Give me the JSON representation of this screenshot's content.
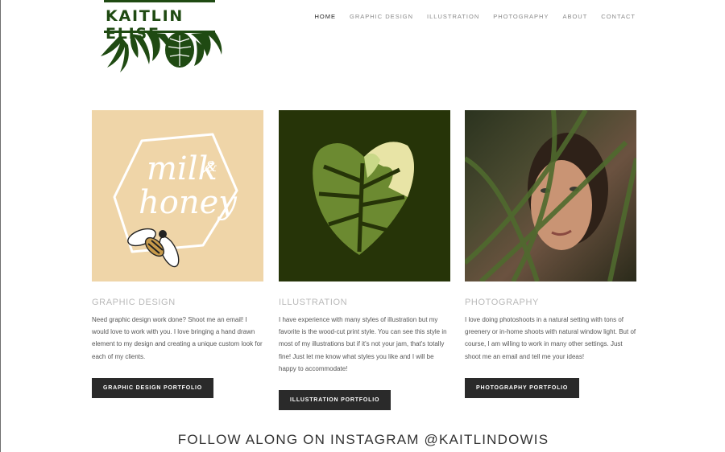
{
  "brand": {
    "name": "KAITLIN ELISE",
    "color": "#1f4a12"
  },
  "nav": [
    {
      "label": "HOME",
      "active": true
    },
    {
      "label": "GRAPHIC DESIGN"
    },
    {
      "label": "ILLUSTRATION"
    },
    {
      "label": "PHOTOGRAPHY"
    },
    {
      "label": "ABOUT"
    },
    {
      "label": "CONTACT"
    }
  ],
  "cards": [
    {
      "title": "GRAPHIC DESIGN",
      "image_text": [
        "milk",
        "&",
        "honey"
      ],
      "body": "Need graphic design work done? Shoot me an email! I would love to work with you. I love bringing a hand drawn element to my design and creating a unique custom look for each of my clients.",
      "button": "GRAPHIC DESIGN PORTFOLIO",
      "bg": "#efd5a8"
    },
    {
      "title": "ILLUSTRATION",
      "body": "I have experience with many styles of illustration but my favorite is the wood-cut print style. You can see this style in most of my illustrations but if it's not your jam, that's totally fine! Just let me know what styles you like and I will be happy to accommodate!",
      "button": "ILLUSTRATION PORTFOLIO",
      "bg": "#263408"
    },
    {
      "title": "PHOTOGRAPHY",
      "body": "I love doing photoshoots in a natural setting with tons of greenery or in-home shoots with natural window light. But of course, I am willing to work in many other settings. Just shoot me an email and tell me your ideas!",
      "button": "PHOTOGRAPHY PORTFOLIO"
    }
  ],
  "instagram": {
    "text": "FOLLOW ALONG ON INSTAGRAM @KAITLINDOWIS"
  }
}
